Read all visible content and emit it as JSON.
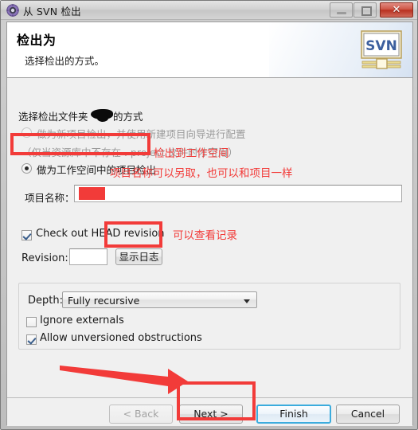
{
  "window": {
    "title": "从 SVN 检出",
    "icon": "svn-gear-icon",
    "buttons": {
      "minimize": "minimize-icon",
      "maximize": "maximize-icon",
      "close": "✕"
    }
  },
  "header": {
    "title": "检出为",
    "subtitle": "选择检出的方式。",
    "logo_text": "SVN"
  },
  "body": {
    "group_label": "选择检出文件夹 ▓▓ 的方式",
    "group_label_visible": "选择检出文件夹",
    "group_label_tail": "的方式",
    "radio_new_project": "做为新项目检出，并使用新建项目向导进行配置",
    "radio_new_project_hint": "（仅当资源库中不存在 . project 文件时才可用）",
    "radio_workspace": "做为工作空间中的项目检出",
    "project_name_label": "项目名称：",
    "project_name_value": "",
    "checkbox_head_revision": "Check out HEAD revision",
    "checkbox_head_revision_checked": true,
    "revision_label": "Revision:",
    "revision_value": "",
    "show_log_button": "显示日志",
    "depth_label": "Depth:",
    "depth_value": "Fully recursive",
    "checkbox_ignore_externals": "Ignore externals",
    "checkbox_ignore_externals_checked": false,
    "checkbox_allow_unversioned": "Allow unversioned obstructions",
    "checkbox_allow_unversioned_checked": true
  },
  "footer": {
    "back": "< Back",
    "next": "Next >",
    "finish": "Finish",
    "cancel": "Cancel"
  },
  "annotations": {
    "workspace_note": "检出到工作空间",
    "project_name_note": "项目名称可以另取，也可以和项目一样",
    "show_log_note": "可以查看记录",
    "color": "#f23b39"
  }
}
